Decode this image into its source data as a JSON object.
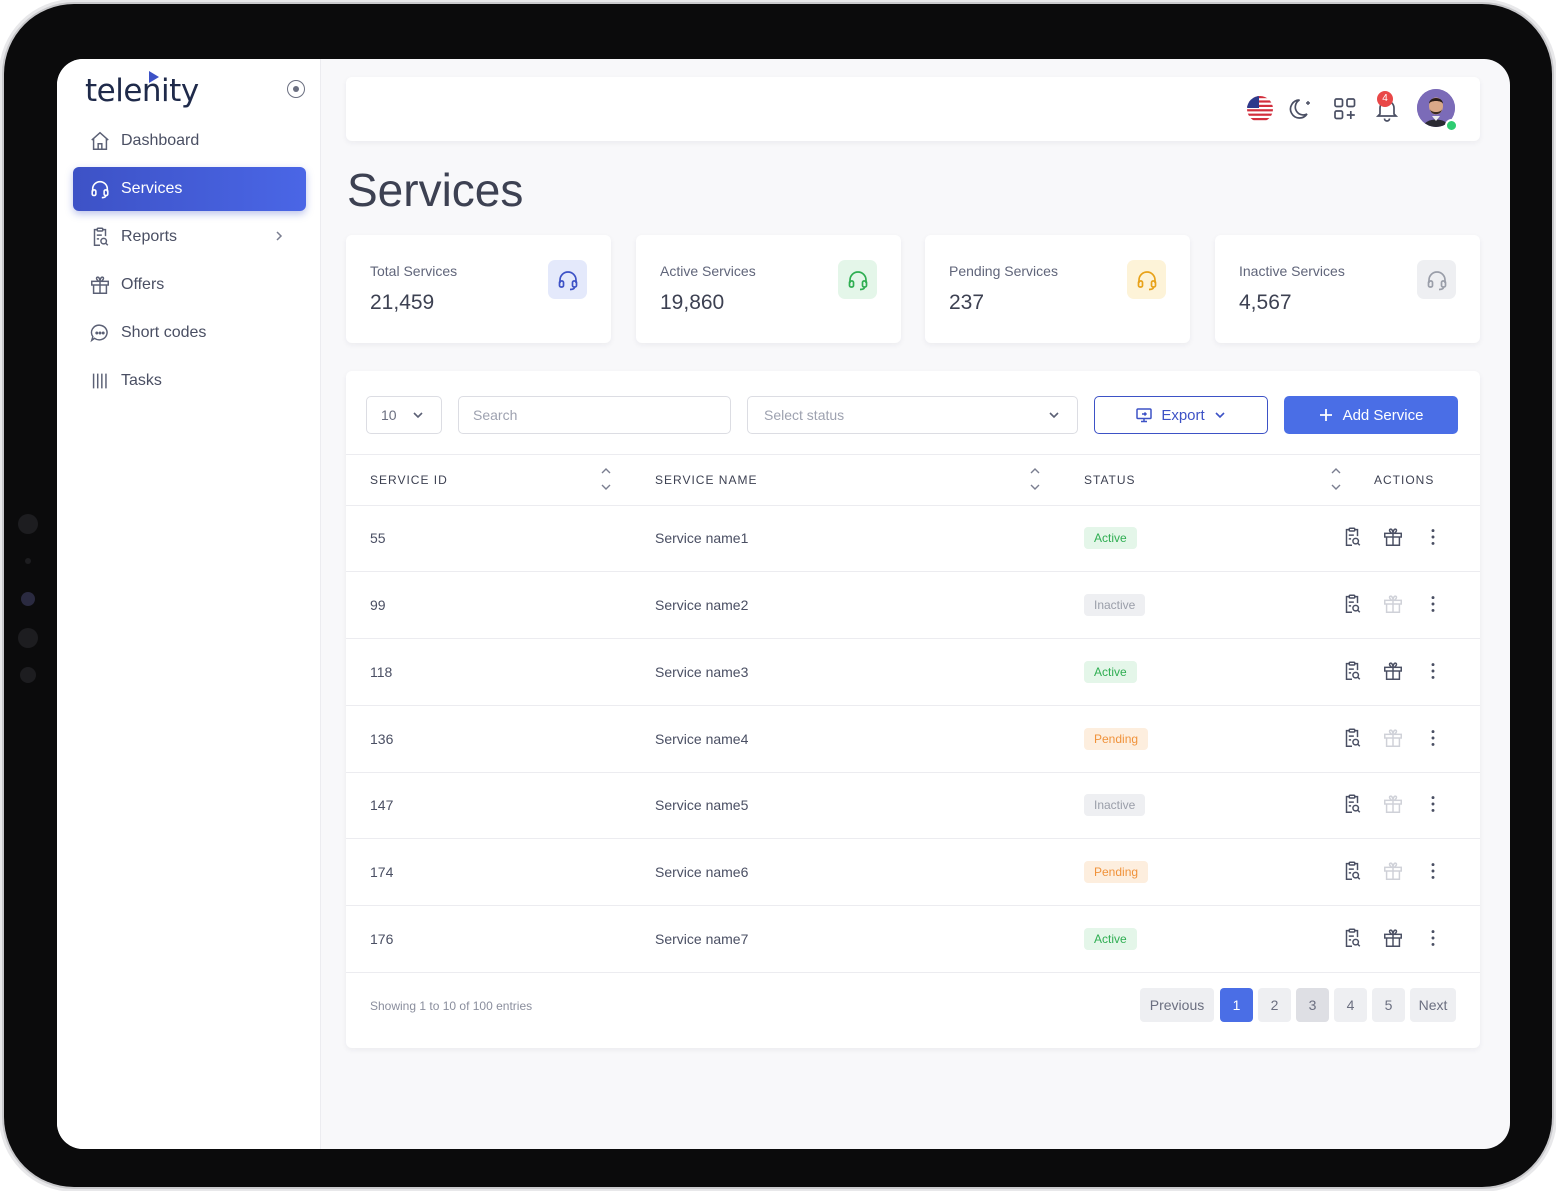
{
  "brand": {
    "name": "telenity"
  },
  "sidebar": {
    "items": [
      {
        "label": "Dashboard",
        "icon": "home-icon",
        "active": false
      },
      {
        "label": "Services",
        "icon": "headset-icon",
        "active": true
      },
      {
        "label": "Reports",
        "icon": "clipboard-search-icon",
        "active": false,
        "has_submenu": true
      },
      {
        "label": "Offers",
        "icon": "gift-icon",
        "active": false
      },
      {
        "label": "Short codes",
        "icon": "chat-bubble-icon",
        "active": false
      },
      {
        "label": "Tasks",
        "icon": "columns-icon",
        "active": false
      }
    ]
  },
  "header": {
    "icons": [
      "us-flag-icon",
      "moon-icon",
      "apps-grid-icon",
      "bell-icon",
      "user-avatar"
    ],
    "notification_count": "4"
  },
  "page": {
    "title": "Services"
  },
  "stats": [
    {
      "label": "Total Services",
      "value": "21,459",
      "color": "#3d52c6",
      "bg": "#e4e9fb"
    },
    {
      "label": "Active Services",
      "value": "19,860",
      "color": "#2fae52",
      "bg": "#e4f6e9"
    },
    {
      "label": "Pending Services",
      "value": "237",
      "color": "#e8a21a",
      "bg": "#fdf3d8"
    },
    {
      "label": "Inactive Services",
      "value": "4,567",
      "color": "#9a9ea9",
      "bg": "#eeeff2"
    }
  ],
  "toolbar": {
    "page_size": "10",
    "search_placeholder": "Search",
    "status_placeholder": "Select status",
    "export_label": "Export",
    "add_label": "Add Service"
  },
  "table": {
    "columns": [
      "SERVICE ID",
      "SERVICE NAME",
      "STATUS",
      "ACTIONS"
    ],
    "rows": [
      {
        "id": "55",
        "name": "Service name1",
        "status": "Active"
      },
      {
        "id": "99",
        "name": "Service name2",
        "status": "Inactive"
      },
      {
        "id": "118",
        "name": "Service name3",
        "status": "Active"
      },
      {
        "id": "136",
        "name": "Service name4",
        "status": "Pending"
      },
      {
        "id": "147",
        "name": "Service name5",
        "status": "Inactive"
      },
      {
        "id": "174",
        "name": "Service name6",
        "status": "Pending"
      },
      {
        "id": "176",
        "name": "Service name7",
        "status": "Active"
      }
    ]
  },
  "footer": {
    "info": "Showing 1 to 10 of 100 entries",
    "prev": "Previous",
    "pages": [
      "1",
      "2",
      "3",
      "4",
      "5"
    ],
    "current_page": "1",
    "next": "Next"
  },
  "colors": {
    "accent": "#4a6ee6",
    "sidebar_active": "#3d52c6"
  }
}
